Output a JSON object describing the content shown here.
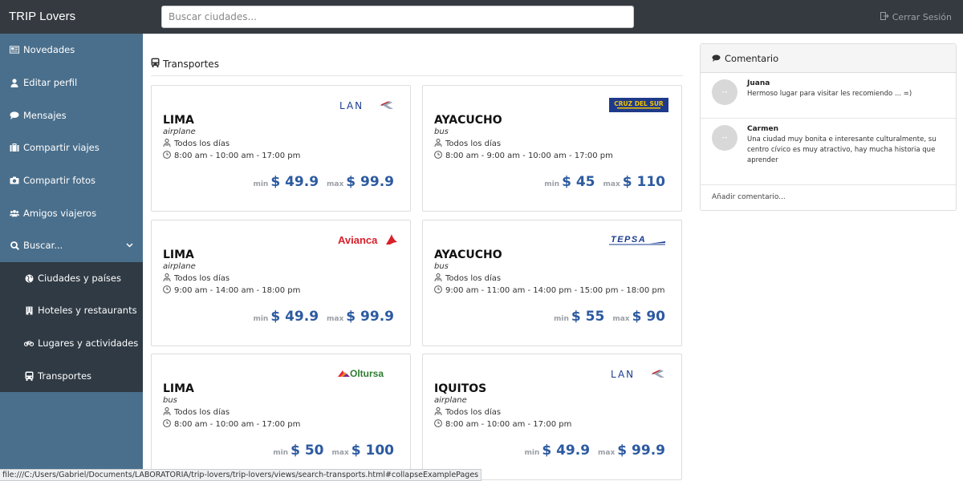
{
  "header": {
    "brand": "TRIP Lovers",
    "search_placeholder": "Buscar ciudades...",
    "logout_label": "Cerrar Sesión"
  },
  "sidebar": {
    "items": [
      {
        "label": "Novedades",
        "icon": "newspaper-icon"
      },
      {
        "label": "Editar perfil",
        "icon": "user-icon"
      },
      {
        "label": "Mensajes",
        "icon": "comment-icon"
      },
      {
        "label": "Compartir viajes",
        "icon": "suitcase-icon"
      },
      {
        "label": "Compartir fotos",
        "icon": "camera-icon"
      },
      {
        "label": "Amigos viajeros",
        "icon": "users-icon"
      },
      {
        "label": "Buscar...",
        "icon": "search-icon"
      }
    ],
    "submenu": [
      {
        "label": "Ciudades y países",
        "icon": "globe-icon"
      },
      {
        "label": "Hoteles y restaurants",
        "icon": "building-icon"
      },
      {
        "label": "Lugares y actividades",
        "icon": "bicycle-icon"
      },
      {
        "label": "Transportes",
        "icon": "bus-icon"
      }
    ]
  },
  "main": {
    "section_title": "Transportes",
    "cards": [
      {
        "city": "LIMA",
        "type": "airplane",
        "frequency": "Todos los días",
        "hours": "8:00 am - 10:00 am - 17:00 pm",
        "min_label": "min",
        "min": "$ 49.9",
        "max_label": "max",
        "max": "$ 99.9",
        "logo": "LAN"
      },
      {
        "city": "AYACUCHO",
        "type": "bus",
        "frequency": "Todos los días",
        "hours": "8:00 am - 9:00 am - 10:00 am - 17:00 pm",
        "min_label": "min",
        "min": "$ 45",
        "max_label": "max",
        "max": "$ 110",
        "logo": "CRUZ DEL SUR"
      },
      {
        "city": "LIMA",
        "type": "airplane",
        "frequency": "Todos los días",
        "hours": "9:00 am - 14:00 am - 18:00 pm",
        "min_label": "min",
        "min": "$ 49.9",
        "max_label": "max",
        "max": "$ 99.9",
        "logo": "Avianca"
      },
      {
        "city": "AYACUCHO",
        "type": "bus",
        "frequency": "Todos los días",
        "hours": "9:00 am - 11:00 am - 14:00 pm - 15:00 pm - 18:00 pm",
        "min_label": "min",
        "min": "$ 55",
        "max_label": "max",
        "max": "$ 90",
        "logo": "TEPSA"
      },
      {
        "city": "LIMA",
        "type": "bus",
        "frequency": "Todos los días",
        "hours": "8:00 am - 10:00 am - 17:00 pm",
        "min_label": "min",
        "min": "$ 50",
        "max_label": "max",
        "max": "$ 100",
        "logo": "Oltursa"
      },
      {
        "city": "IQUITOS",
        "type": "airplane",
        "frequency": "Todos los días",
        "hours": "8:00 am - 10:00 am - 17:00 pm",
        "min_label": "min",
        "min": "$ 49.9",
        "max_label": "max",
        "max": "$ 99.9",
        "logo": "LAN"
      }
    ]
  },
  "comments": {
    "title": "Comentario",
    "items": [
      {
        "name": "Juana",
        "text": "Hermoso lugar para visitar les recomiendo ... =)"
      },
      {
        "name": "Carmen",
        "text": "Una ciudad muy bonita e interesante culturalmente, su centro cívico es muy atractivo, hay mucha historia que aprender"
      }
    ],
    "add_placeholder": "Añadir comentario..."
  },
  "statusbar": "file:///C:/Users/Gabriel/Documents/LABORATORIA/trip-lovers/trip-lovers/views/search-transports.html#collapseExamplePages",
  "colors": {
    "topbar": "#343a40",
    "sidebar": "#4a6f8c",
    "submenu": "#2f3a44",
    "price": "#2c5aa0"
  }
}
